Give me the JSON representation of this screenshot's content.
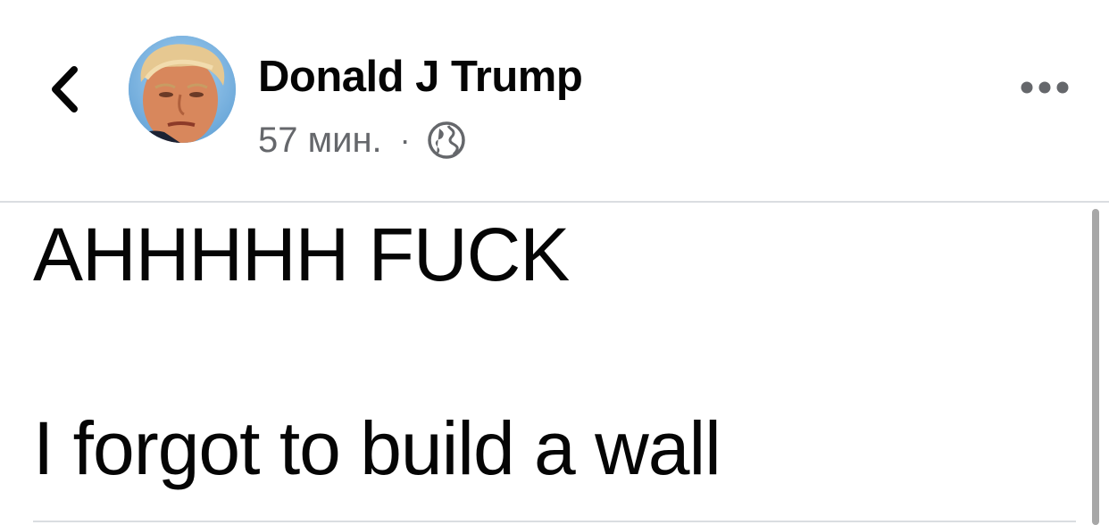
{
  "header": {
    "back_icon": "chevron-left-icon",
    "author_name": "Donald J Trump",
    "time_ago": "57 мин.",
    "separator": "·",
    "privacy_icon": "globe-icon",
    "more_icon": "more-horizontal-icon"
  },
  "post": {
    "line1": "AHHHHH FUCK",
    "line2": "I forgot to build a wall"
  },
  "colors": {
    "text_primary": "#050505",
    "text_secondary": "#65676b",
    "divider": "#dadde1",
    "scrollbar": "#a7a7a7"
  }
}
